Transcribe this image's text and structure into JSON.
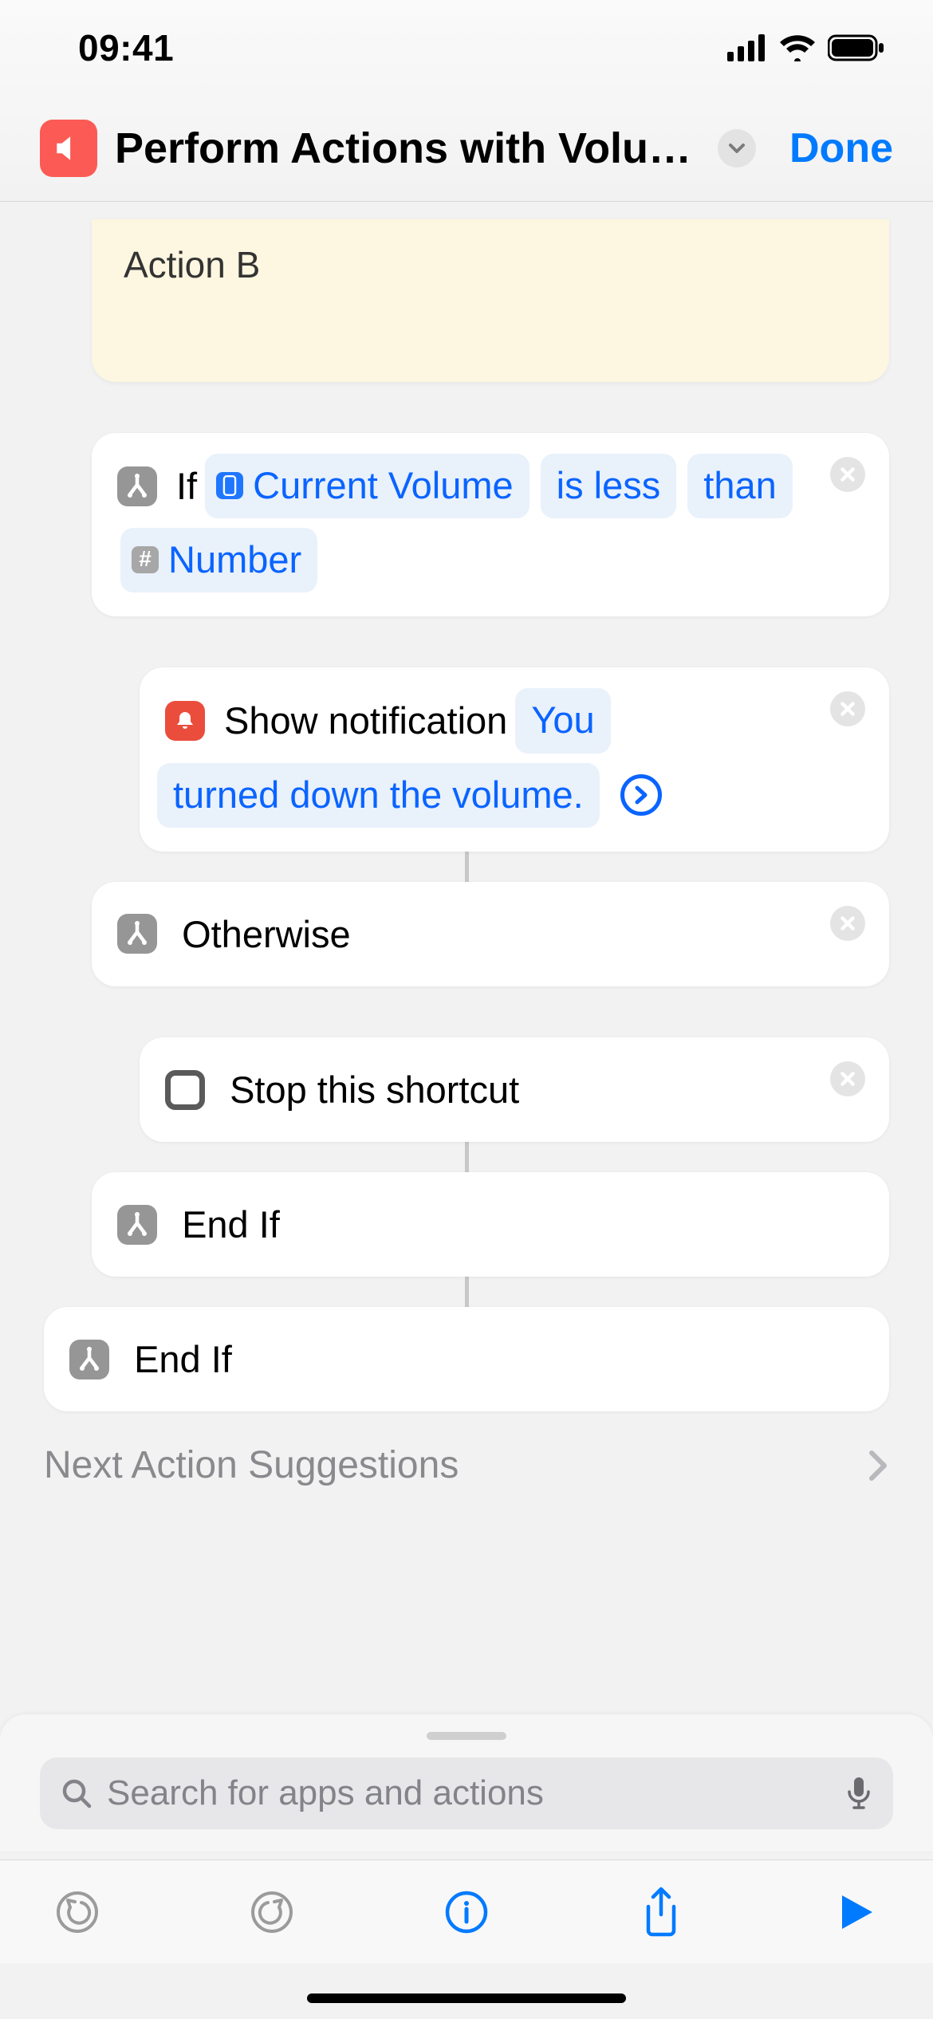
{
  "status": {
    "time": "09:41"
  },
  "header": {
    "title": "Perform Actions with Volum…",
    "done": "Done"
  },
  "note": {
    "text": "Action B"
  },
  "actions": {
    "if": {
      "keyword": "If",
      "var": "Current Volume",
      "cond1": "is less",
      "cond2": "than",
      "param": "Number"
    },
    "notify": {
      "label": "Show notification",
      "message1": "You",
      "message2": "turned down the volume."
    },
    "otherwise": {
      "label": "Otherwise"
    },
    "stop": {
      "label": "Stop this shortcut"
    },
    "endif1": {
      "label": "End If"
    },
    "endif2": {
      "label": "End If"
    }
  },
  "suggestions": {
    "title": "Next Action Suggestions"
  },
  "search": {
    "placeholder": "Search for apps and actions"
  }
}
